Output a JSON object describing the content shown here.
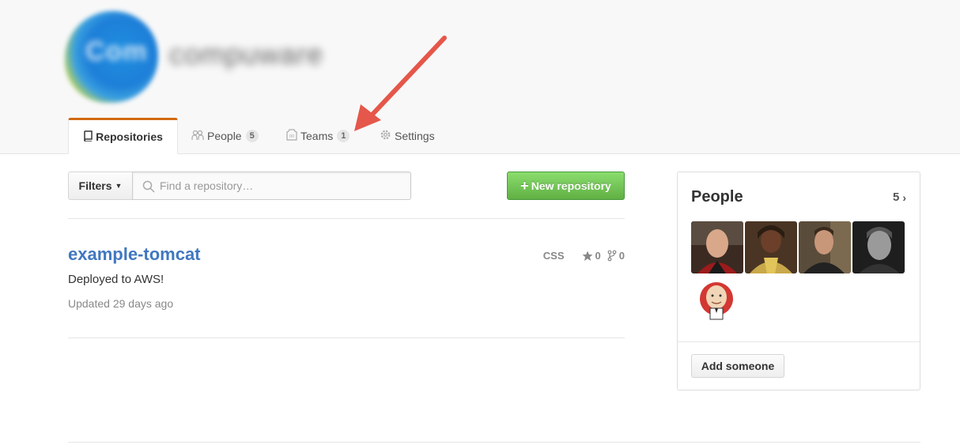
{
  "org": {
    "name": "compuware",
    "logo_text": "Com"
  },
  "tabs": [
    {
      "label": "Repositories",
      "icon": "repo-icon",
      "selected": true
    },
    {
      "label": "People",
      "icon": "people-icon",
      "count": "5"
    },
    {
      "label": "Teams",
      "icon": "jersey-icon",
      "count": "1"
    },
    {
      "label": "Settings",
      "icon": "gear-icon"
    }
  ],
  "toolbar": {
    "filters_label": "Filters",
    "search_placeholder": "Find a repository…",
    "search_value": "",
    "new_repo_label": "New repository"
  },
  "repos": [
    {
      "name": "example-tomcat",
      "description": "Deployed to AWS!",
      "updated": "Updated 29 days ago",
      "language": "CSS",
      "stars": "0",
      "forks": "0"
    }
  ],
  "people_panel": {
    "title": "People",
    "count": "5",
    "add_label": "Add someone"
  },
  "colors": {
    "accent_tab": "#d26911",
    "link": "#4078c0",
    "new_repo_button": "#60b044",
    "annotation_arrow": "#e5574a"
  }
}
